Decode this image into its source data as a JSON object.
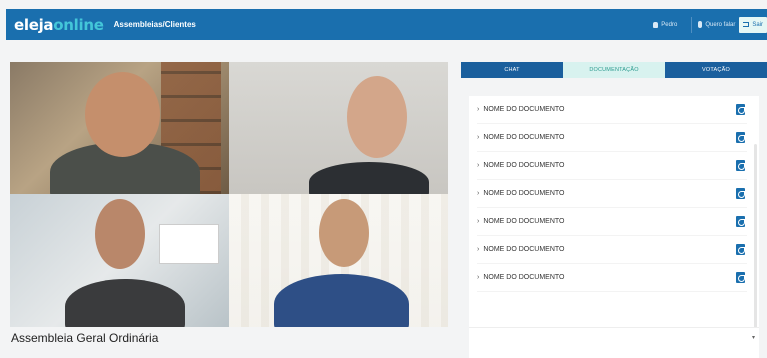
{
  "header": {
    "logo_part1": "eleja",
    "logo_part2": "online",
    "breadcrumb": "Assembleias/Clientes",
    "user_name": "Pedro",
    "speak_label": "Quero falar",
    "exit_label": "Sair"
  },
  "meeting": {
    "title": "Assembleia Geral Ordinária"
  },
  "tabs": [
    {
      "label": "CHAT"
    },
    {
      "label": "DOCUMENTAÇÃO"
    },
    {
      "label": "VOTAÇÃO"
    }
  ],
  "documents": [
    {
      "name": "NOME DO DOCUMENTO"
    },
    {
      "name": "NOME DO DOCUMENTO"
    },
    {
      "name": "NOME DO DOCUMENTO"
    },
    {
      "name": "NOME DO DOCUMENTO"
    },
    {
      "name": "NOME DO DOCUMENTO"
    },
    {
      "name": "NOME DO DOCUMENTO"
    },
    {
      "name": "NOME DO DOCUMENTO"
    }
  ],
  "icons": {
    "user": "user-icon",
    "mic": "mic-icon",
    "exit": "exit-icon",
    "pdf": "pdf-icon",
    "chevron": "chevron-right-icon"
  },
  "colors": {
    "header_bg": "#1a6fae",
    "logo_accent": "#43c6d9",
    "tab_dark": "#1a5f9d",
    "tab_active_bg": "#d8f2ef",
    "tab_active_text": "#2b9a8e"
  }
}
